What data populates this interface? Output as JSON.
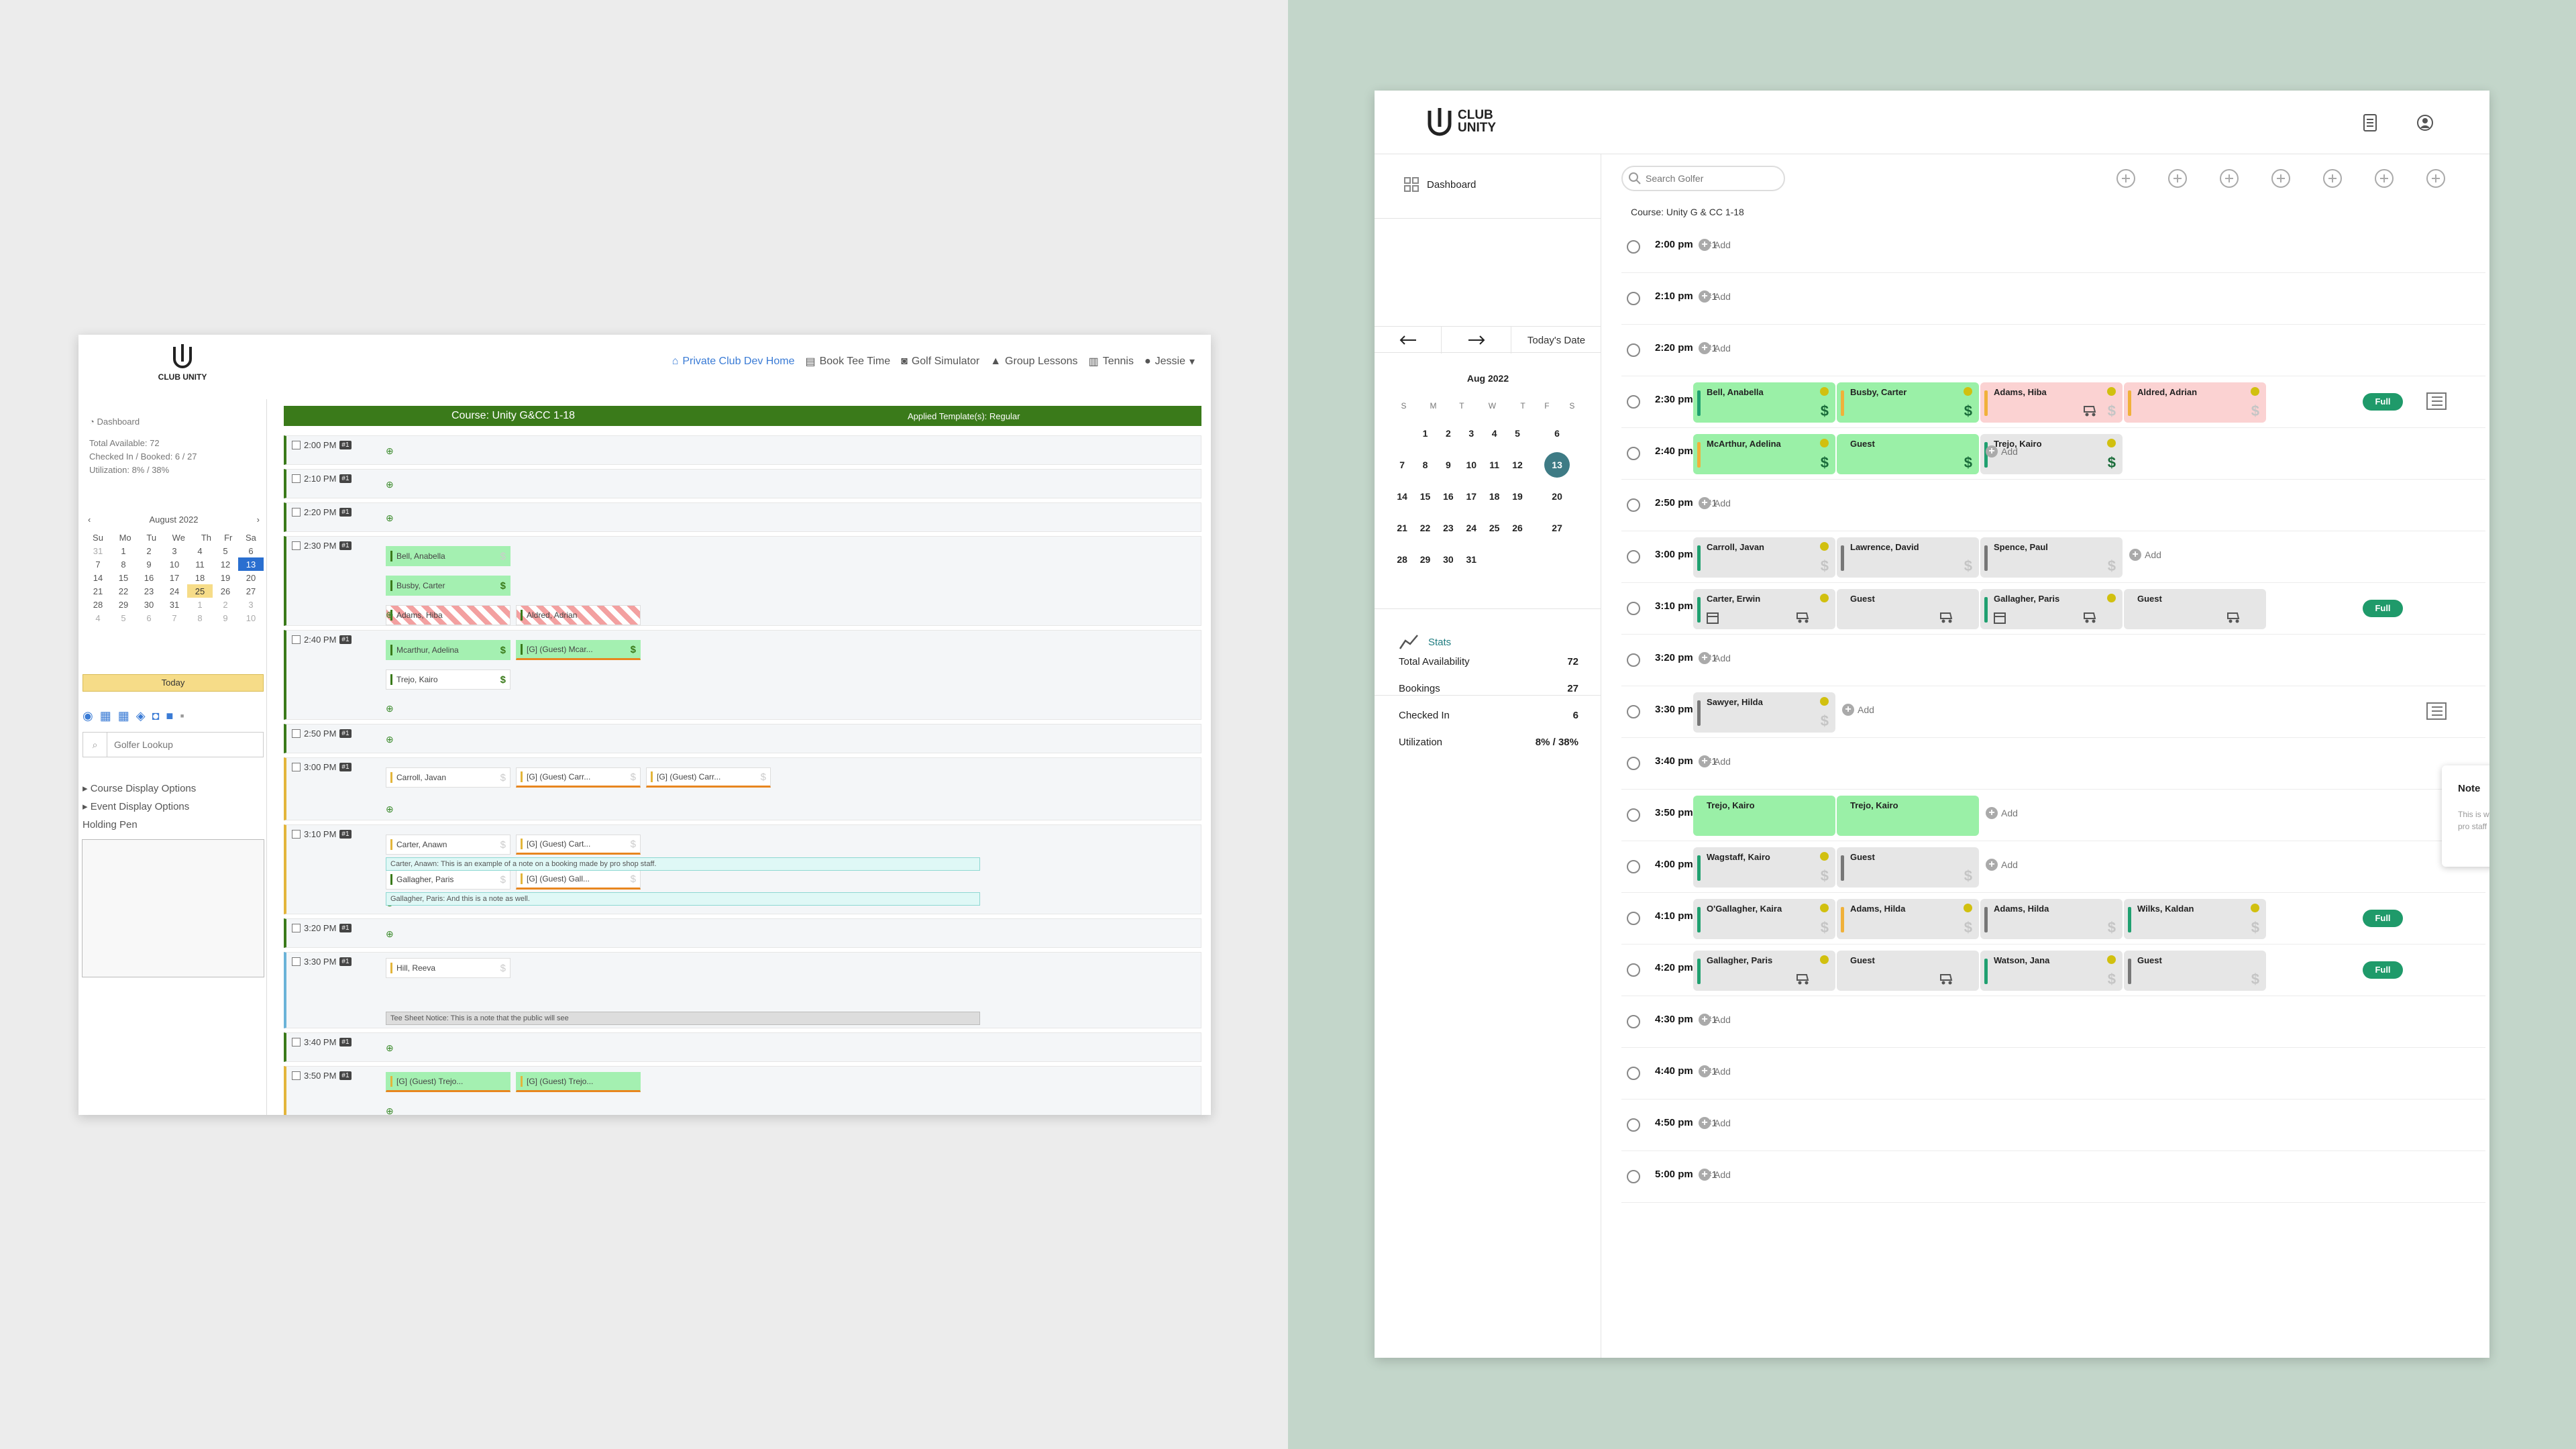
{
  "old_ui": {
    "brand": "CLUB UNITY",
    "nav": [
      {
        "label": "Private Club Dev Home",
        "icon": "home-icon"
      },
      {
        "label": "Book Tee Time",
        "icon": "booking-icon"
      },
      {
        "label": "Golf Simulator",
        "icon": "vr-icon"
      },
      {
        "label": "Group Lessons",
        "icon": "graduation-cap-icon"
      },
      {
        "label": "Tennis",
        "icon": "building-icon"
      },
      {
        "label": "Jessie",
        "icon": "user-icon"
      }
    ],
    "sidebar": {
      "dashboard": "Dashboard",
      "total_available": "Total Available: 72",
      "checked_in": "Checked In / Booked: 6 / 27",
      "utilization": "Utilization: 8% / 38%",
      "month": "August 2022",
      "today": "Today",
      "lookup_placeholder": "Golfer Lookup",
      "course_display": "Course Display Options",
      "event_display": "Event Display Options",
      "holding_pen": "Holding Pen"
    },
    "calendar": {
      "days": [
        "Su",
        "Mo",
        "Tu",
        "We",
        "Th",
        "Fr",
        "Sa"
      ],
      "weeks": [
        [
          "31",
          "1",
          "2",
          "3",
          "4",
          "5",
          "6"
        ],
        [
          "7",
          "8",
          "9",
          "10",
          "11",
          "12",
          "13"
        ],
        [
          "14",
          "15",
          "16",
          "17",
          "18",
          "19",
          "20"
        ],
        [
          "21",
          "22",
          "23",
          "24",
          "25",
          "26",
          "27"
        ],
        [
          "28",
          "29",
          "30",
          "31",
          "1",
          "2",
          "3"
        ],
        [
          "4",
          "5",
          "6",
          "7",
          "8",
          "9",
          "10"
        ]
      ]
    },
    "course_header": "Course: Unity G&CC 1-18",
    "applied_template": "Applied Template(s): Regular",
    "hole": "#1",
    "times": [
      "2:00 PM",
      "2:10 PM",
      "2:20 PM",
      "2:30 PM",
      "2:40 PM",
      "2:50 PM",
      "3:00 PM",
      "3:10 PM",
      "3:20 PM",
      "3:30 PM",
      "3:40 PM",
      "3:50 PM"
    ],
    "players": {
      "bell": "Bell, Anabella",
      "busby": "Busby, Carter",
      "adams": "Adams, Hiba",
      "aldred": "Aldred, Adrian",
      "mcarthur": "Mcarthur, Adelina",
      "mcar_guest": "[G] (Guest) Mcar...",
      "trejo": "Trejo, Kairo",
      "carroll": "Carroll, Javan",
      "carr_guest": "[G] (Guest) Carr...",
      "carter": "Carter, Anawn",
      "cart_guest": "[G] (Guest) Cart...",
      "gallagher": "Gallagher, Paris",
      "gall_guest": "[G] (Guest) Gall...",
      "hill": "Hill, Reeva",
      "trejo_guest": "[G] (Guest) Trejo..."
    },
    "notes": {
      "carter": "Carter, Anawn: This is an example of a note on a booking made by pro shop staff.",
      "gallagher": "Gallagher, Paris: And this is a note as well.",
      "teesheet": "Tee Sheet Notice: This is a note that the public will see"
    }
  },
  "new_ui": {
    "brand_line1": "CLUB",
    "brand_line2": "UNITY",
    "dashboard": "Dashboard",
    "search_placeholder": "Search Golfer",
    "course": "Course: Unity G & CC 1-18",
    "todays_date": "Today's Date",
    "month": "Aug 2022",
    "days": [
      "S",
      "M",
      "T",
      "W",
      "T",
      "F",
      "S"
    ],
    "weeks": [
      [
        "",
        "1",
        "2",
        "3",
        "4",
        "5",
        "6"
      ],
      [
        "7",
        "8",
        "9",
        "10",
        "11",
        "12",
        "13"
      ],
      [
        "14",
        "15",
        "16",
        "17",
        "18",
        "19",
        "20"
      ],
      [
        "21",
        "22",
        "23",
        "24",
        "25",
        "26",
        "27"
      ],
      [
        "28",
        "29",
        "30",
        "31",
        "",
        "",
        ""
      ]
    ],
    "stats_title": "Stats",
    "stats": [
      {
        "label": "Total Availability",
        "value": "72"
      },
      {
        "label": "Bookings",
        "value": "27"
      },
      {
        "label": "Checked In",
        "value": "6"
      },
      {
        "label": "Utilization",
        "value": "8% / 38%"
      }
    ],
    "hole": "#1",
    "add": "Add",
    "full": "Full",
    "times": [
      "2:00 pm",
      "2:10 pm",
      "2:20 pm",
      "2:30 pm",
      "2:40 pm",
      "2:50 pm",
      "3:00 pm",
      "3:10 pm",
      "3:20 pm",
      "3:30 pm",
      "3:40 pm",
      "3:50 pm",
      "4:00 pm",
      "4:10 pm",
      "4:20 pm",
      "4:30 pm",
      "4:40 pm",
      "4:50 pm",
      "5:00 pm"
    ],
    "names": {
      "bell": "Bell, Anabella",
      "busby": "Busby, Carter",
      "adams": "Adams, Hiba",
      "aldred": "Aldred, Adrian",
      "mcarthur": "McArthur, Adelina",
      "guest": "Guest",
      "trejo": "Trejo, Kairo",
      "carroll": "Carroll, Javan",
      "lawrence": "Lawrence, David",
      "spence": "Spence, Paul",
      "carter": "Carter, Erwin",
      "gallagher": "Gallagher, Paris",
      "sawyer": "Sawyer, Hilda",
      "wagstaff": "Wagstaff, Kairo",
      "ogallagher": "O'Gallagher, Kaira",
      "adamsh": "Adams, Hilda",
      "wilks": "Wilks, Kaldan",
      "watson": "Watson, Jana"
    },
    "note_title": "Note",
    "note_body": "This is where comments appear when a golfer or a pro staff makes a note regarding a booking."
  }
}
